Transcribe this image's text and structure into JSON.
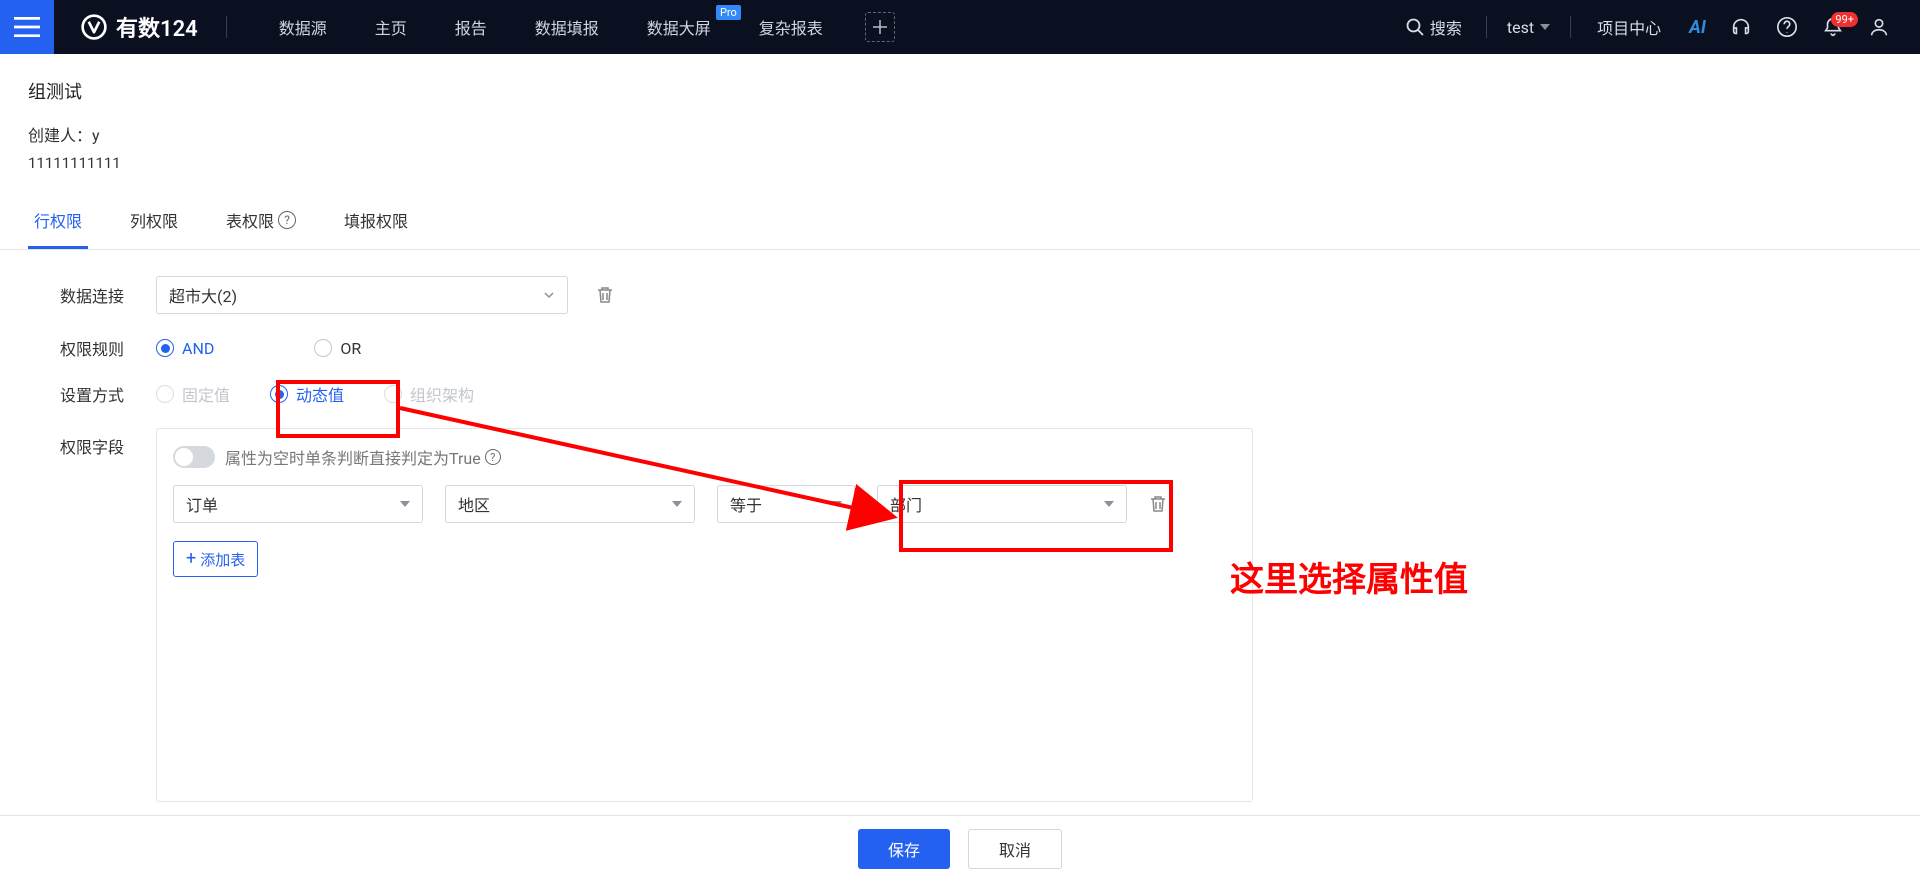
{
  "header": {
    "app_name": "有数124",
    "nav": [
      "数据源",
      "主页",
      "报告",
      "数据填报",
      "数据大屏",
      "复杂报表"
    ],
    "pro_badge": "Pro",
    "search_label": "搜索",
    "user_name": "test",
    "project_center": "项目中心",
    "ai_label": "AI",
    "notification_count": "99+"
  },
  "page": {
    "title": "组测试",
    "creator_label": "创建人：",
    "creator_value": "y",
    "description": "11111111111"
  },
  "tabs": {
    "t0": "行权限",
    "t1": "列权限",
    "t2": "表权限",
    "t3": "填报权限"
  },
  "form": {
    "data_conn_label": "数据连接",
    "data_conn_value": "超市大(2)",
    "rule_label": "权限规则",
    "rule_opt_and": "AND",
    "rule_opt_or": "OR",
    "mode_label": "设置方式",
    "mode_opt_fixed": "固定值",
    "mode_opt_dynamic": "动态值",
    "mode_opt_org": "组织架构",
    "field_label": "权限字段",
    "toggle_text": "属性为空时单条判断直接判定为True",
    "dd_table": "订单",
    "dd_region": "地区",
    "dd_op": "等于",
    "dd_value": "部门",
    "add_table": "添加表"
  },
  "annotation": {
    "text": "这里选择属性值"
  },
  "footer": {
    "save": "保存",
    "cancel": "取消"
  }
}
